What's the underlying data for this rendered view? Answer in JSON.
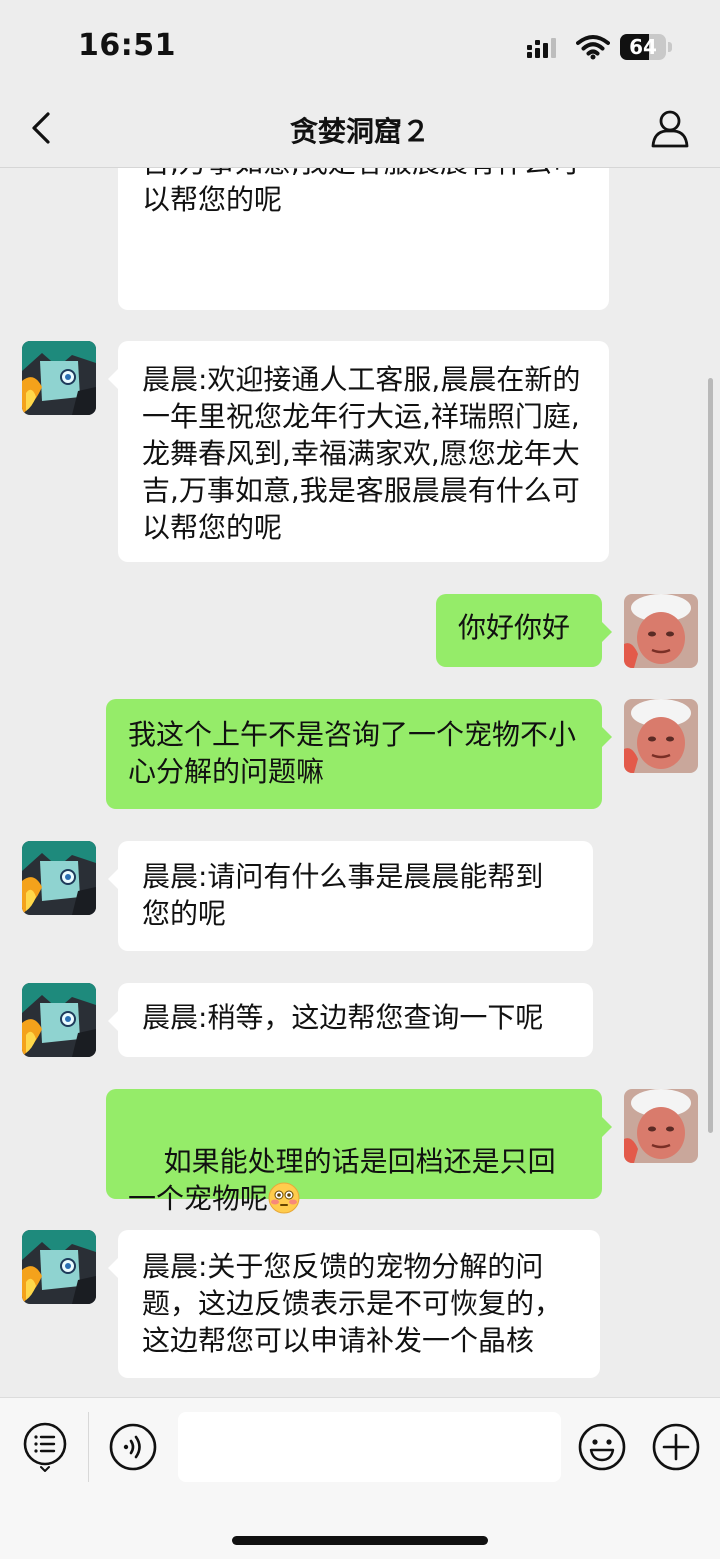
{
  "status_bar": {
    "time": "16:51",
    "battery": "64",
    "battery_level": 0.64
  },
  "nav": {
    "title": "贪婪洞窟２"
  },
  "colors": {
    "background": "#ededed",
    "incoming_bubble": "#ffffff",
    "outgoing_bubble": "#95ec69"
  },
  "messages": [
    {
      "side": "left",
      "avatar": "support-avatar",
      "text": "晨晨:欢迎接通人工客服,晨晨在新的一年里祝您龙年行大运,祥瑞照门庭,龙舞春风到,幸福满家欢,愿您龙年大吉,万事如意,我是客服晨晨有什么可以帮您的呢"
    },
    {
      "side": "left",
      "avatar": "support-avatar",
      "text": "晨晨:欢迎接通人工客服,晨晨在新的一年里祝您龙年行大运,祥瑞照门庭,龙舞春风到,幸福满家欢,愿您龙年大吉,万事如意,我是客服晨晨有什么可以帮您的呢"
    },
    {
      "side": "right",
      "avatar": "user-avatar",
      "text": "你好你好"
    },
    {
      "side": "right",
      "avatar": "user-avatar",
      "text": "我这个上午不是咨询了一个宠物不小心分解的问题嘛"
    },
    {
      "side": "left",
      "avatar": "support-avatar",
      "text": "晨晨:请问有什么事是晨晨能帮到您的呢"
    },
    {
      "side": "left",
      "avatar": "support-avatar",
      "text": "晨晨:稍等，这边帮您查询一下呢"
    },
    {
      "side": "right",
      "avatar": "user-avatar",
      "text": "如果能处理的话是回档还是只回一个宠物呢",
      "emoji": "flushed-face"
    },
    {
      "side": "left",
      "avatar": "support-avatar",
      "text": "晨晨:关于您反馈的宠物分解的问题，这边反馈表示是不可恢复的，这边帮您可以申请补发一个晶核"
    }
  ],
  "input_bar": {
    "placeholder": "",
    "value": ""
  }
}
